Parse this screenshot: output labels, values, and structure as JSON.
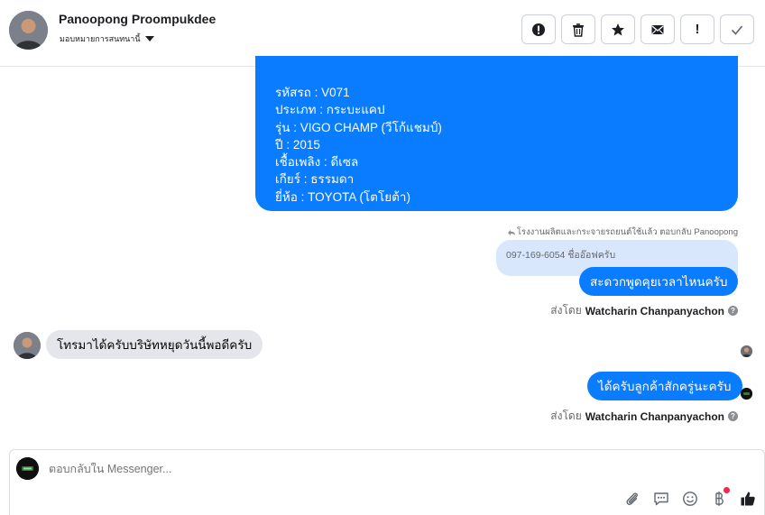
{
  "header": {
    "name": "Panoopong Proompukdee",
    "assign_label": "มอบหมายการสนทนานี้",
    "actions": [
      {
        "icon": "alert-circle-icon"
      },
      {
        "icon": "trash-icon"
      },
      {
        "icon": "star-icon"
      },
      {
        "icon": "envelope-icon"
      },
      {
        "icon": "exclamation-icon",
        "text": "!"
      },
      {
        "icon": "check-icon"
      }
    ]
  },
  "messages": {
    "spec_lines": [
      "รหัสรถ : V071",
      "ประเภท : กระบะแคป",
      "รุ่น : VIGO CHAMP (วีโก้แชมป์)",
      "ปี : 2015",
      "เชื้อเพลิง : ดีเซล",
      "เกียร์ : ธรรมดา",
      "ยี่ห้อ : TOYOTA (โตโยต้า)"
    ],
    "reply_note": "โรงงานผลิตและกระจายรถยนต์ใช้แล้ว ตอบกลับ Panoopong",
    "quoted_text": "097-169-6054 ชื่ออ๊อฟครับ",
    "outgoing_1": "สะดวกพูดคุยเวลาไหนครับ",
    "sent_by_prefix": "ส่งโดย",
    "sent_by_name": "Watcharin Chanpanyachon",
    "incoming_1": "โทรมาได้ครับบริษัทหยุดวันนี้พอดีครับ",
    "outgoing_2": "ได้ครับลูกค้าสักครู่นะครับ"
  },
  "composer": {
    "placeholder": "ตอบกลับใน Messenger...",
    "tools": [
      "paperclip-icon",
      "chat-icon",
      "emoji-icon",
      "baht-icon",
      "thumbs-up-icon"
    ]
  },
  "colors": {
    "accent": "#0a7cff",
    "quote_bg": "#d8e7fc",
    "incoming_bg": "#e4e6eb",
    "notification_dot": "#f02849"
  }
}
